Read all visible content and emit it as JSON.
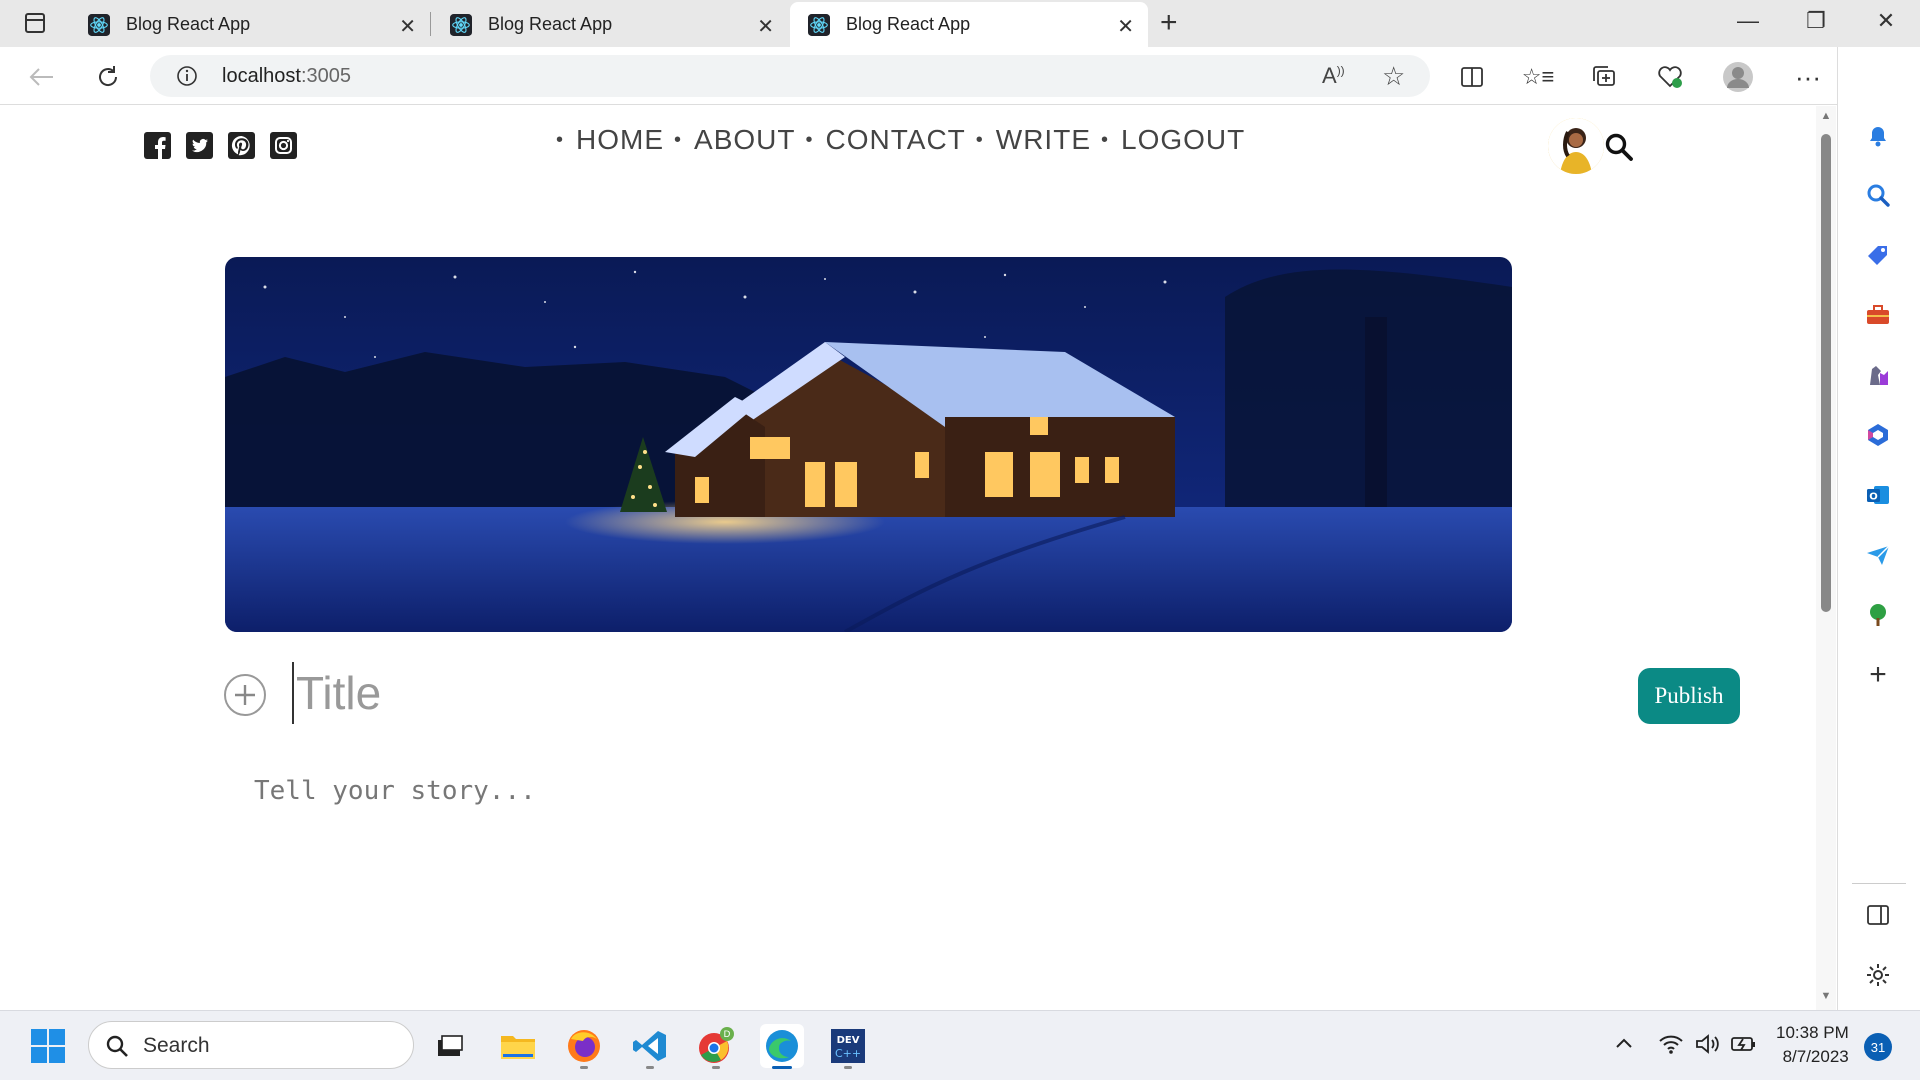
{
  "browser": {
    "tabs": [
      {
        "title": "Blog React App"
      },
      {
        "title": "Blog React App"
      },
      {
        "title": "Blog React App"
      }
    ],
    "url_host": "localhost",
    "url_port": ":3005"
  },
  "nav": {
    "items": [
      "HOME",
      "ABOUT",
      "CONTACT",
      "WRITE",
      "LOGOUT"
    ]
  },
  "editor": {
    "title_placeholder": "Title",
    "story_placeholder": "Tell your story...",
    "publish_label": "Publish"
  },
  "taskbar": {
    "search_label": "Search",
    "time": "10:38 PM",
    "date": "8/7/2023",
    "notification_count": "31"
  },
  "colors": {
    "publish": "#0b8a85",
    "edge_blue": "#0a5fb4"
  }
}
